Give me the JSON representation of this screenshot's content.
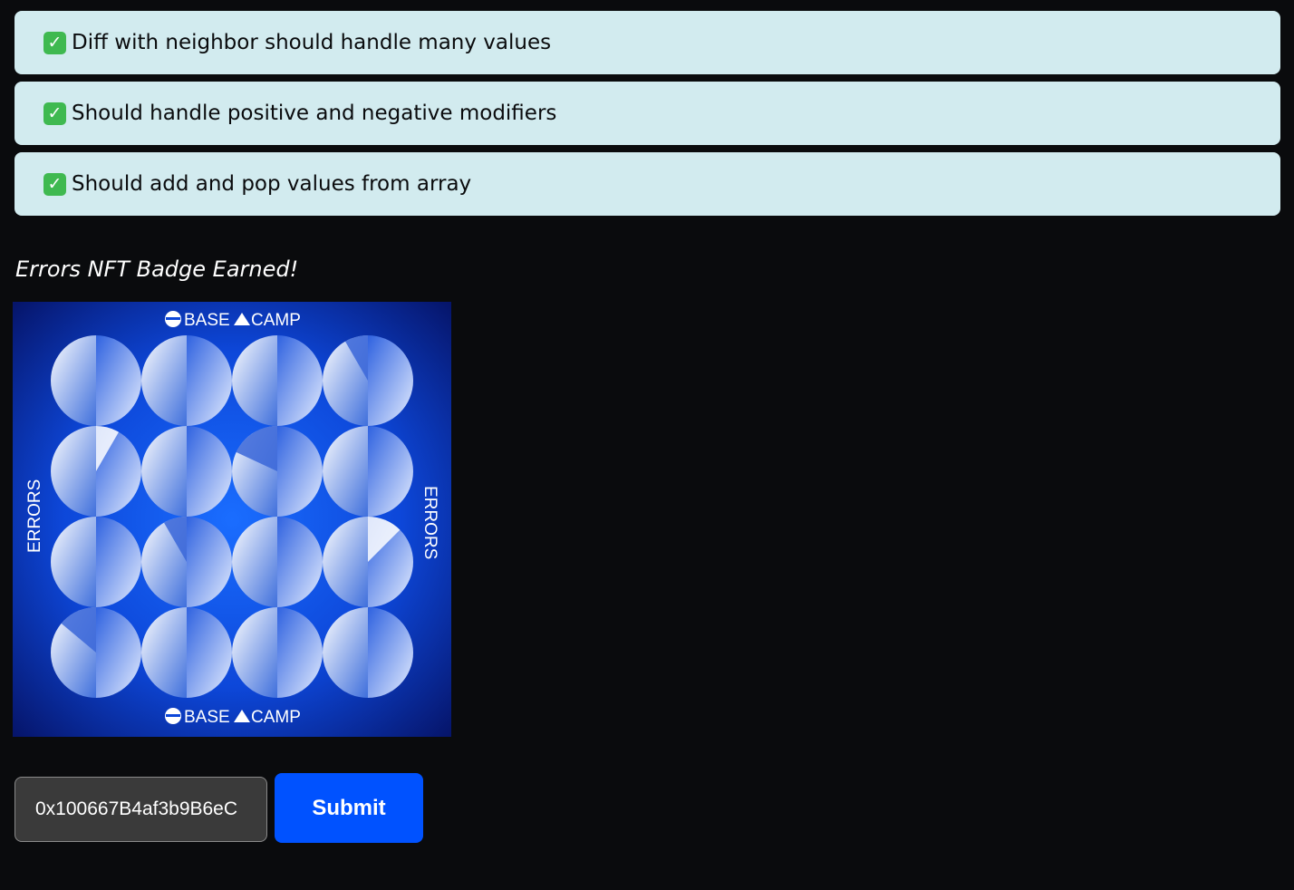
{
  "tests": [
    {
      "status_icon": "check-mark-icon",
      "label": "Diff with neighbor should handle many values"
    },
    {
      "status_icon": "check-mark-icon",
      "label": "Should handle positive and negative modifiers"
    },
    {
      "status_icon": "check-mark-icon",
      "label": "Should add and pop values from array"
    }
  ],
  "badge": {
    "heading": "Errors NFT Badge Earned!",
    "brand_left": "BASE",
    "brand_right": "CAMP",
    "side_label": "ERRORS"
  },
  "form": {
    "address_value": "0x100667B4af3b9B6eC",
    "submit_label": "Submit"
  },
  "colors": {
    "test_background": "#d2ebef",
    "check_green": "#3fb950",
    "submit_blue": "#0052ff",
    "page_background": "#0a0b0d"
  }
}
